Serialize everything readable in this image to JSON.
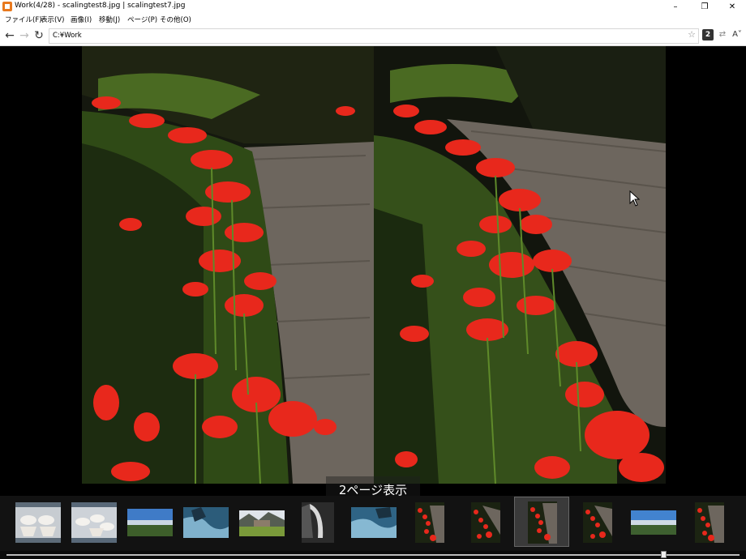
{
  "window": {
    "title": "Work(4/28) - scalingtest8.jpg | scalingtest7.jpg",
    "minimize_glyph": "–",
    "restore_glyph": "❐",
    "close_glyph": "✕"
  },
  "menu": [
    {
      "label": "ファイル(F)"
    },
    {
      "label": "表示(V)"
    },
    {
      "label": "画像(I)"
    },
    {
      "label": "移動(J)"
    },
    {
      "label": "ページ(P)"
    },
    {
      "label": "その他(O)"
    }
  ],
  "toolbar": {
    "back_glyph": "←",
    "forward_glyph": "→",
    "reload_glyph": "↻",
    "address": "C:¥Work",
    "star_glyph": "☆",
    "two_page_label": "2",
    "arrows_glyph": "⇄",
    "font_glyph": "A˅"
  },
  "viewer": {
    "overlay_text": "2ページ表示"
  },
  "thumbnails": [
    {
      "kind": "bowls"
    },
    {
      "kind": "bowls"
    },
    {
      "kind": "landscape"
    },
    {
      "kind": "water"
    },
    {
      "kind": "village"
    },
    {
      "kind": "cave"
    },
    {
      "kind": "water"
    },
    {
      "kind": "flowers"
    },
    {
      "kind": "flowers"
    },
    {
      "kind": "flowers",
      "selected": true
    },
    {
      "kind": "flowers"
    },
    {
      "kind": "landscape"
    },
    {
      "kind": "flowers"
    }
  ],
  "scrollbar": {
    "position": 0.9
  },
  "colors": {
    "flower_red": "#e8281c",
    "path_gray": "#6d665e",
    "grass_green": "#4f7a22",
    "accent_orange": "#e8791e"
  }
}
